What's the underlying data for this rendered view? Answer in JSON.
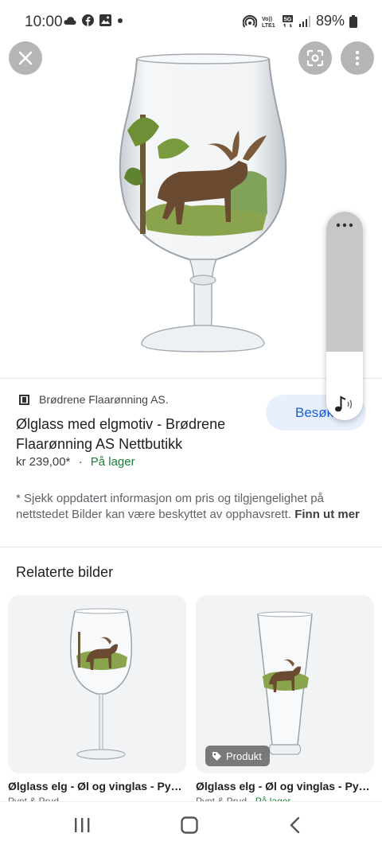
{
  "status_bar": {
    "time": "10:00",
    "left_icons": [
      "cloud-icon",
      "facebook-icon",
      "image-icon",
      "dot-icon"
    ],
    "right_icons": [
      "hotspot-icon",
      "volte-icon",
      "5g-icon",
      "signal-icon",
      "battery-icon"
    ],
    "volte_label": "VoLTE1",
    "network": "5G",
    "battery": "89%"
  },
  "viewer": {
    "close_icon": "close-icon",
    "lens_icon": "google-lens-icon",
    "more_icon": "more-vertical-icon",
    "image_subject": "moose-beer-glass"
  },
  "volume_panel": {
    "dots_icon": "more-horizontal-icon",
    "note_icon": "music-note-icon",
    "level": 0.33
  },
  "result": {
    "source": "Brødrene Flaarønning AS.",
    "source_icon": "site-favicon",
    "visit_label": "Besøk",
    "title": "Ølglass med elgmotiv - Brødrene Flaarønning AS Nettbutikk",
    "price": "kr 239,00*",
    "separator": "·",
    "availability": "På lager",
    "disclaimer": "* Sjekk oppdatert informasjon om pris og tilgjengelighet på nettstedet Bilder kan være beskyttet av opphavsrett.",
    "learn_more": "Finn ut mer"
  },
  "related": {
    "heading": "Relaterte bilder",
    "items": [
      {
        "title": "Ølglass elg - Øl og vinglas - Pyn...",
        "source": "Pynt & Prud",
        "availability": "",
        "badge": ""
      },
      {
        "title": "Ølglass elg - Øl og vinglas - Pyn...",
        "source": "Pynt & Prud",
        "availability": "På lager",
        "badge": "Produkt"
      }
    ]
  },
  "nav": {
    "recents_icon": "recents-icon",
    "home_icon": "home-icon",
    "back_icon": "back-icon"
  },
  "colors": {
    "accent": "#1a5fc9",
    "visit_bg": "#e8f0fe",
    "stock_green": "#188038"
  }
}
